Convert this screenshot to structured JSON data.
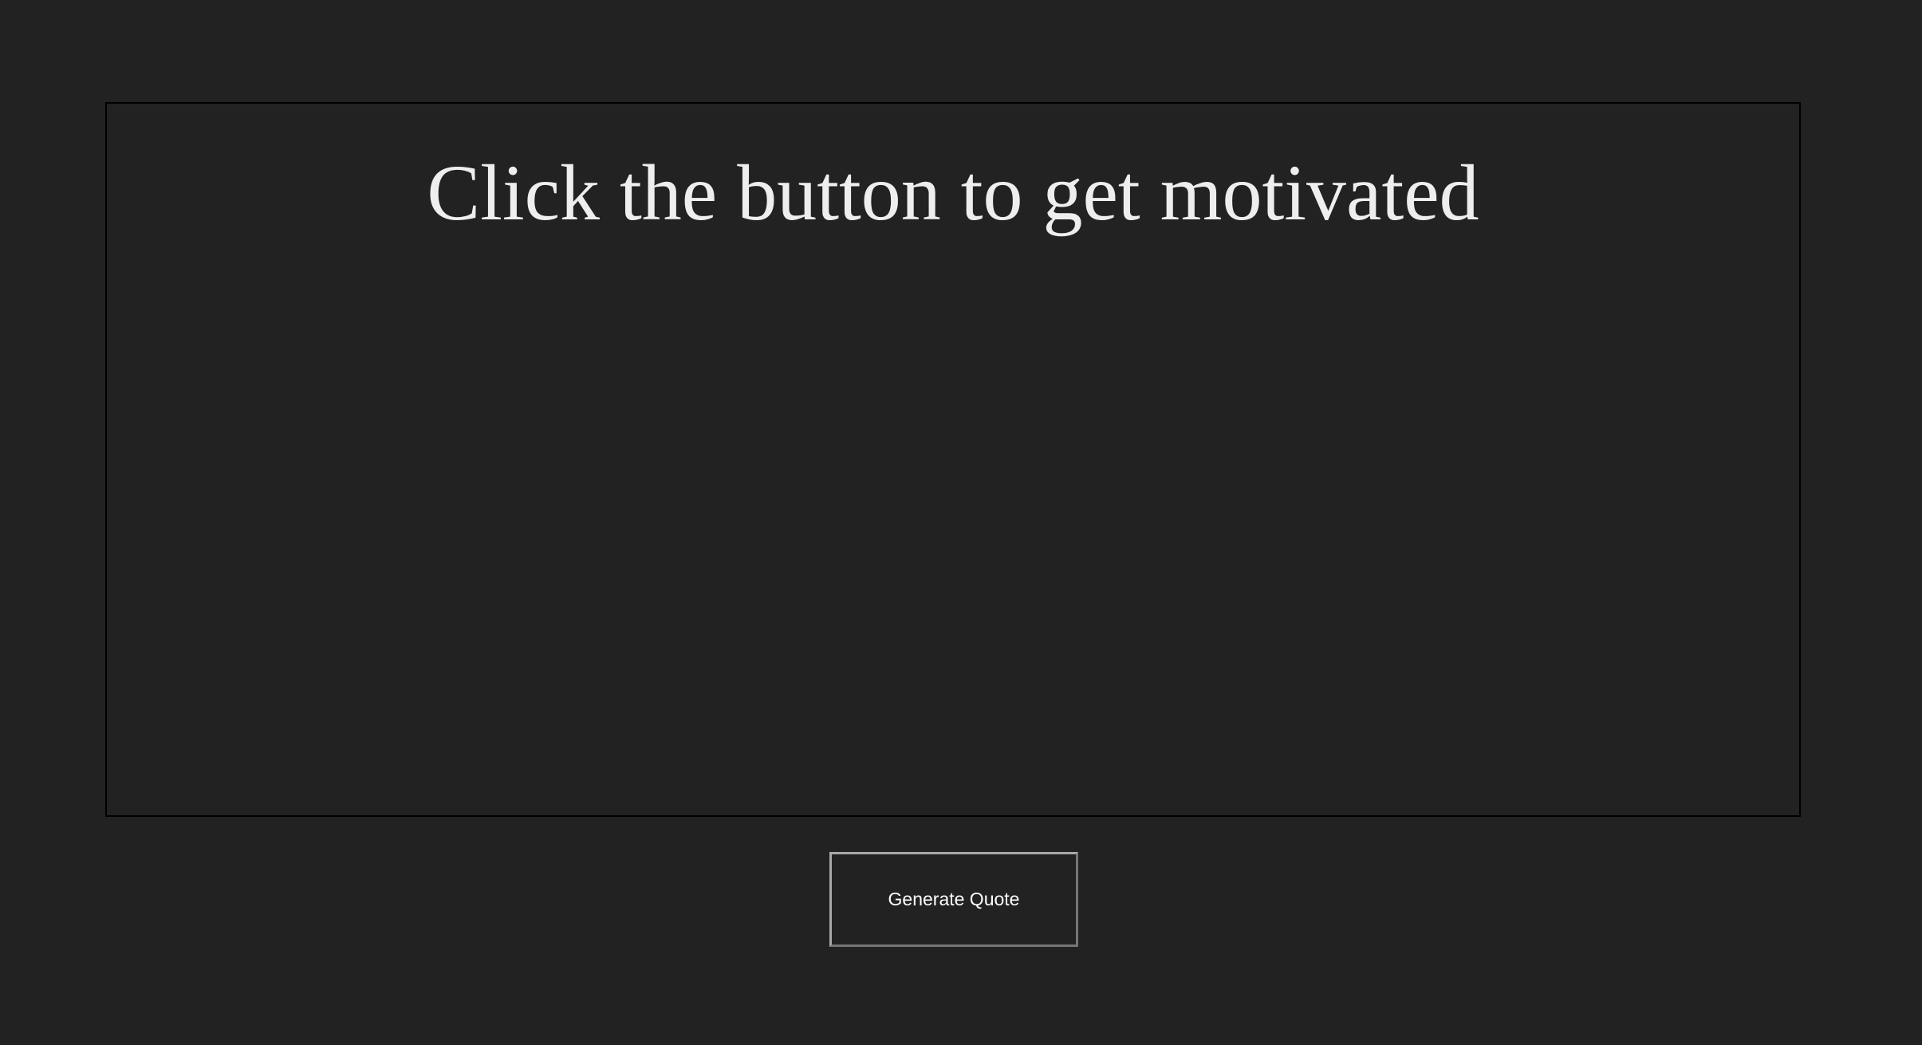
{
  "quote": {
    "text": "Click the button to get motivated"
  },
  "controls": {
    "generate_label": "Generate Quote"
  },
  "colors": {
    "background": "#222222",
    "text": "#eeeeee",
    "box_border": "#000000",
    "button_border": "#a9a9a9"
  }
}
